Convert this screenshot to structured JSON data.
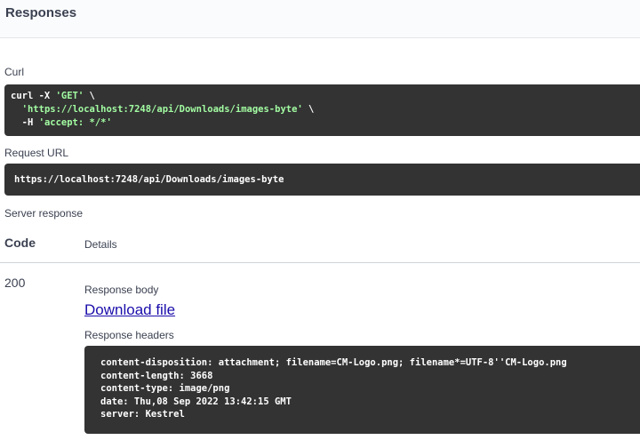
{
  "responses": {
    "title": "Responses"
  },
  "curl": {
    "label": "Curl",
    "line1_prefix": "curl -X ",
    "line1_method": "'GET'",
    "line1_suffix": " \\",
    "line2_url": "'https://localhost:7248/api/Downloads/images-byte'",
    "line2_suffix": " \\",
    "line3_prefix": "-H ",
    "line3_header": "'accept: */*'"
  },
  "request_url": {
    "label": "Request URL",
    "value": "https://localhost:7248/api/Downloads/images-byte"
  },
  "server_response": {
    "label": "Server response",
    "code_header": "Code",
    "details_header": "Details",
    "status_code": "200",
    "body_label": "Response body",
    "download_link": "Download file",
    "headers_label": "Response headers",
    "headers": [
      "content-disposition: attachment; filename=CM-Logo.png; filename*=UTF-8''CM-Logo.png",
      "content-length: 3668",
      "content-type: image/png",
      "date: Thu,08 Sep 2022 13:42:15 GMT",
      "server: Kestrel"
    ]
  },
  "colors": {
    "code_background": "#333333",
    "string_highlight": "#a2fca2",
    "link": "#1a0dab",
    "text": "#3b4151"
  }
}
